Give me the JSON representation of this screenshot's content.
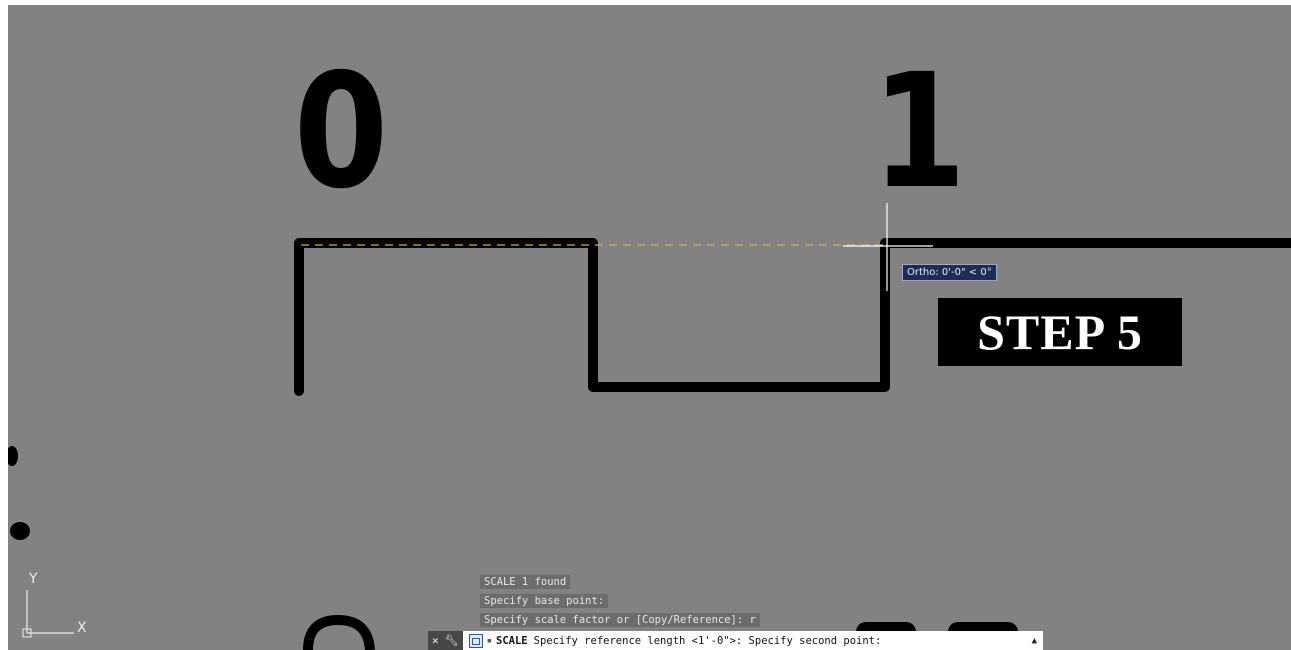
{
  "drawing": {
    "label_zero": "0",
    "label_one": "1"
  },
  "tooltip": {
    "text": "Ortho: 0'-0\" < 0°"
  },
  "step_label": "STEP 5",
  "command_history": [
    "SCALE 1 found",
    "Specify base point:",
    "Specify scale factor or [Copy/Reference]: r"
  ],
  "command_line": {
    "close_icon": "close-icon",
    "customize_icon": "wrench-icon",
    "prompt_icon": "command-prompt-icon",
    "separator": "▪",
    "command_name": "SCALE",
    "prompt_text": "Specify reference length <1'-0\">:  Specify second point:",
    "history_toggle_icon": "up-arrow-icon"
  },
  "ucs": {
    "y_label": "Y",
    "x_label": "X"
  },
  "colors": {
    "background": "#828282",
    "geometry": "#000000",
    "crosshair": "#ffffff",
    "rubber_band": "#e0a850",
    "tooltip_bg": "#1e2c56"
  }
}
